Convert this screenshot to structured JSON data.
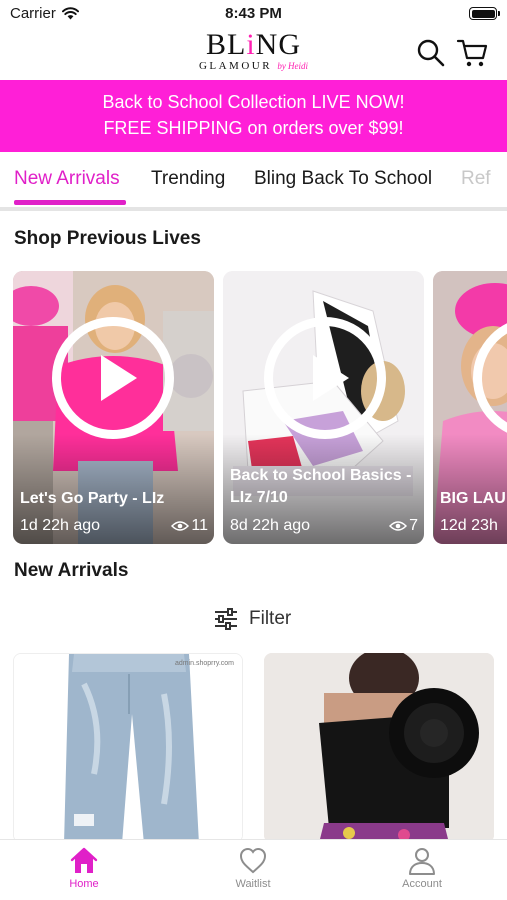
{
  "status_bar": {
    "carrier": "Carrier",
    "time": "8:43 PM"
  },
  "header": {
    "logo_main_1": "BL",
    "logo_main_i": "i",
    "logo_main_2": "NG",
    "logo_sub": "GLAMOUR",
    "logo_by": "by Heidi",
    "search_icon": "search-icon",
    "cart_icon": "cart-icon"
  },
  "promo": {
    "line1": "Back to School Collection LIVE NOW!",
    "line2": "FREE SHIPPING on orders over $99!",
    "background": "#ff1fd7"
  },
  "tabs": [
    {
      "label": "New Arrivals",
      "active": true
    },
    {
      "label": "Trending",
      "active": false
    },
    {
      "label": "Bling Back To School",
      "active": false
    },
    {
      "label": "Ref",
      "active": false
    }
  ],
  "accent_color": "#e020c8",
  "lives": {
    "title": "Shop Previous Lives",
    "items": [
      {
        "title": "Let's Go Party - LIz",
        "time": "1d 22h ago",
        "views": "11"
      },
      {
        "title": "Back to School Basics - LIz 7/10",
        "time": "8d 22h ago",
        "views": "7"
      },
      {
        "title": "BIG LAU",
        "time": "12d 23h",
        "views": ""
      }
    ]
  },
  "new_arrivals": {
    "title": "New Arrivals",
    "filter_label": "Filter",
    "products": [
      {
        "image": "light-wash-jeans",
        "url_tag": "admin.shoprry.com"
      },
      {
        "image": "black-rosette-top"
      }
    ]
  },
  "bottom_nav": [
    {
      "label": "Home",
      "icon": "home-icon",
      "active": true
    },
    {
      "label": "Waitlist",
      "icon": "heart-icon",
      "active": false
    },
    {
      "label": "Account",
      "icon": "user-icon",
      "active": false
    }
  ]
}
